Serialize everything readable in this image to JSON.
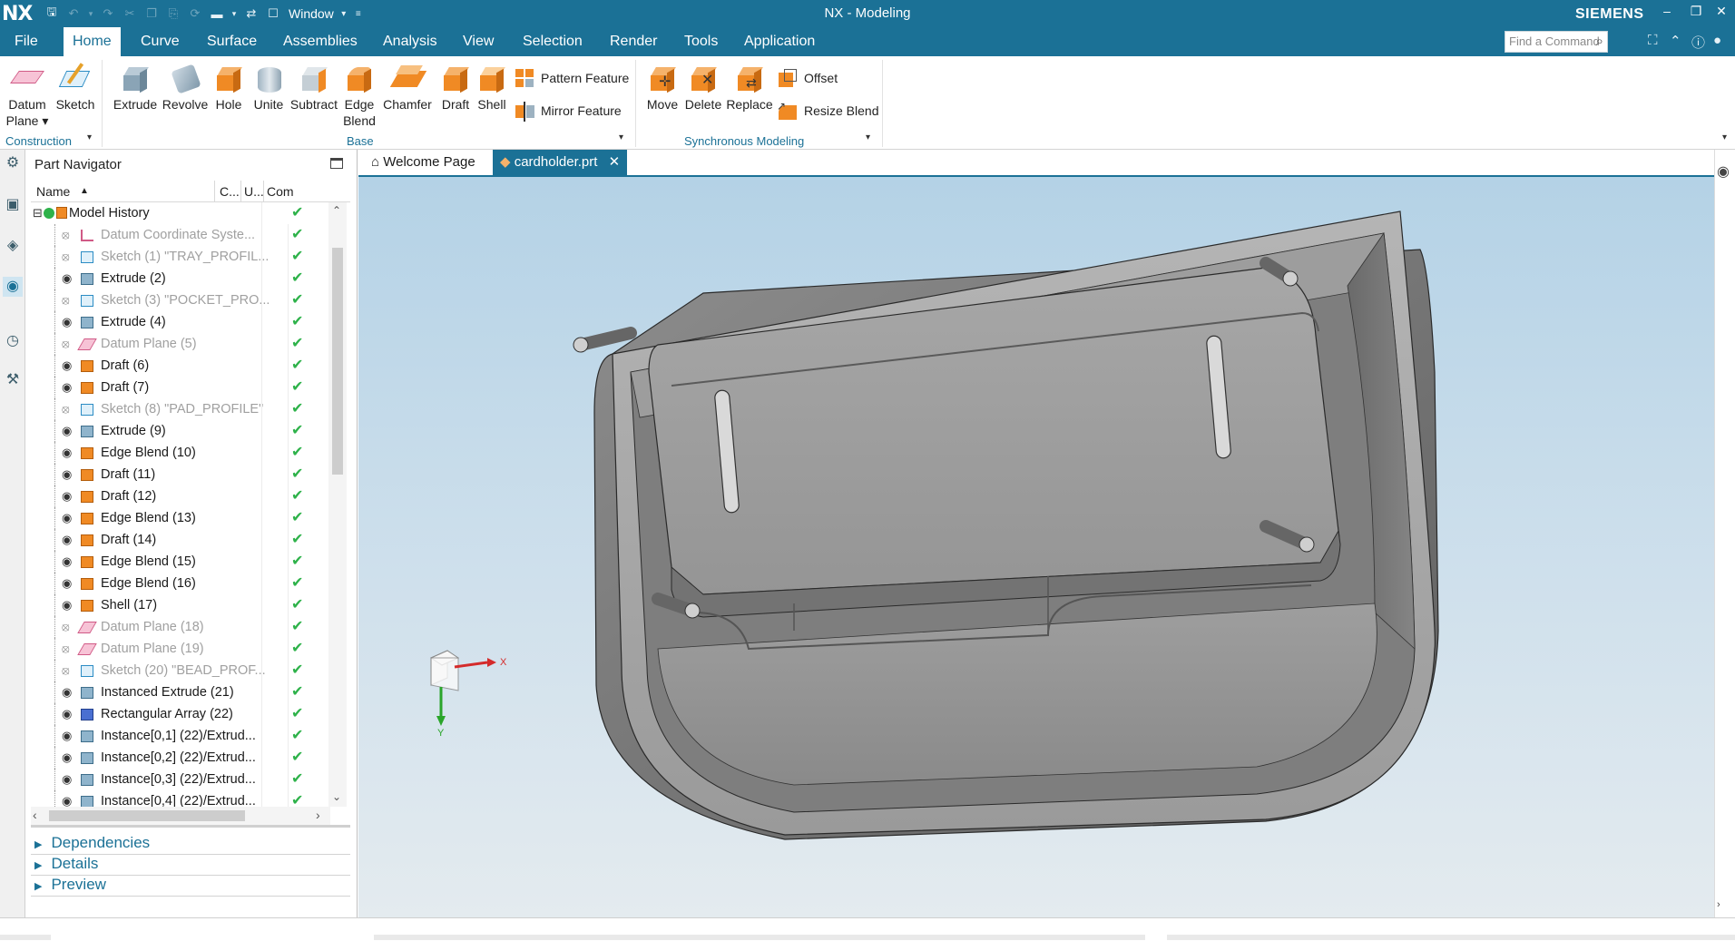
{
  "app": {
    "logo": "NX",
    "title": "NX - Modeling",
    "brand": "SIEMENS",
    "window_menu": "Window"
  },
  "menu": {
    "items": [
      "File",
      "Home",
      "Curve",
      "Surface",
      "Assemblies",
      "Analysis",
      "View",
      "Selection",
      "Render",
      "Tools",
      "Application"
    ],
    "active": "Home",
    "find_placeholder": "Find a Command"
  },
  "ribbon": {
    "construction": {
      "label": "Construction",
      "buttons": [
        {
          "line1": "Datum",
          "line2": "Plane ▾"
        },
        {
          "line1": "Sketch",
          "line2": ""
        }
      ]
    },
    "base": {
      "label": "Base",
      "buttons": [
        {
          "line1": "Extrude",
          "line2": ""
        },
        {
          "line1": "Revolve",
          "line2": ""
        },
        {
          "line1": "Hole",
          "line2": ""
        },
        {
          "line1": "Unite",
          "line2": ""
        },
        {
          "line1": "Subtract",
          "line2": ""
        },
        {
          "line1": "Edge",
          "line2": "Blend"
        },
        {
          "line1": "Chamfer",
          "line2": ""
        },
        {
          "line1": "Draft",
          "line2": ""
        },
        {
          "line1": "Shell",
          "line2": ""
        }
      ],
      "small": [
        "Pattern Feature",
        "Mirror Feature"
      ]
    },
    "sync": {
      "label": "Synchronous Modeling",
      "buttons": [
        {
          "line1": "Move",
          "line2": ""
        },
        {
          "line1": "Delete",
          "line2": ""
        },
        {
          "line1": "Replace",
          "line2": ""
        }
      ],
      "small": [
        "Offset",
        "Resize Blend"
      ]
    }
  },
  "navigator": {
    "title": "Part Navigator",
    "columns": [
      "Name",
      "C...",
      "U...",
      "Com"
    ],
    "root": "Model History",
    "rows": [
      {
        "name": "Datum Coordinate Syste...",
        "dim": true,
        "icon": "datum-csys"
      },
      {
        "name": "Sketch (1) \"TRAY_PROFIL...",
        "dim": true,
        "icon": "sketch"
      },
      {
        "name": "Extrude (2)",
        "dim": false,
        "icon": "extrude"
      },
      {
        "name": "Sketch (3) \"POCKET_PRO...",
        "dim": true,
        "icon": "sketch"
      },
      {
        "name": "Extrude (4)",
        "dim": false,
        "icon": "extrude"
      },
      {
        "name": "Datum Plane (5)",
        "dim": true,
        "icon": "datum-plane"
      },
      {
        "name": "Draft (6)",
        "dim": false,
        "icon": "feature"
      },
      {
        "name": "Draft (7)",
        "dim": false,
        "icon": "feature"
      },
      {
        "name": "Sketch (8) \"PAD_PROFILE\"",
        "dim": true,
        "icon": "sketch"
      },
      {
        "name": "Extrude (9)",
        "dim": false,
        "icon": "extrude"
      },
      {
        "name": "Edge Blend (10)",
        "dim": false,
        "icon": "feature"
      },
      {
        "name": "Draft (11)",
        "dim": false,
        "icon": "feature"
      },
      {
        "name": "Draft (12)",
        "dim": false,
        "icon": "feature"
      },
      {
        "name": "Edge Blend (13)",
        "dim": false,
        "icon": "feature"
      },
      {
        "name": "Draft (14)",
        "dim": false,
        "icon": "feature"
      },
      {
        "name": "Edge Blend (15)",
        "dim": false,
        "icon": "feature"
      },
      {
        "name": "Edge Blend (16)",
        "dim": false,
        "icon": "feature"
      },
      {
        "name": "Shell (17)",
        "dim": false,
        "icon": "feature"
      },
      {
        "name": "Datum Plane (18)",
        "dim": true,
        "icon": "datum-plane"
      },
      {
        "name": "Datum Plane (19)",
        "dim": true,
        "icon": "datum-plane"
      },
      {
        "name": "Sketch (20) \"BEAD_PROF...",
        "dim": true,
        "icon": "sketch"
      },
      {
        "name": "Instanced Extrude (21)",
        "dim": false,
        "icon": "extrude"
      },
      {
        "name": "Rectangular Array (22)",
        "dim": false,
        "icon": "array"
      },
      {
        "name": "Instance[0,1] (22)/Extrud...",
        "dim": false,
        "icon": "extrude"
      },
      {
        "name": "Instance[0,2] (22)/Extrud...",
        "dim": false,
        "icon": "extrude"
      },
      {
        "name": "Instance[0,3] (22)/Extrud...",
        "dim": false,
        "icon": "extrude"
      },
      {
        "name": "Instance[0,4] (22)/Extrud...",
        "dim": false,
        "icon": "extrude"
      }
    ],
    "panels": [
      "Dependencies",
      "Details",
      "Preview"
    ]
  },
  "tabs": [
    {
      "label": "Welcome Page",
      "active": false
    },
    {
      "label": "cardholder.prt",
      "active": true
    }
  ],
  "triad": {
    "x_label": "X",
    "y_label": "Y"
  },
  "colors": {
    "accent": "#1b7196",
    "check": "#2eb24a",
    "feature_orange": "#f08a24"
  }
}
